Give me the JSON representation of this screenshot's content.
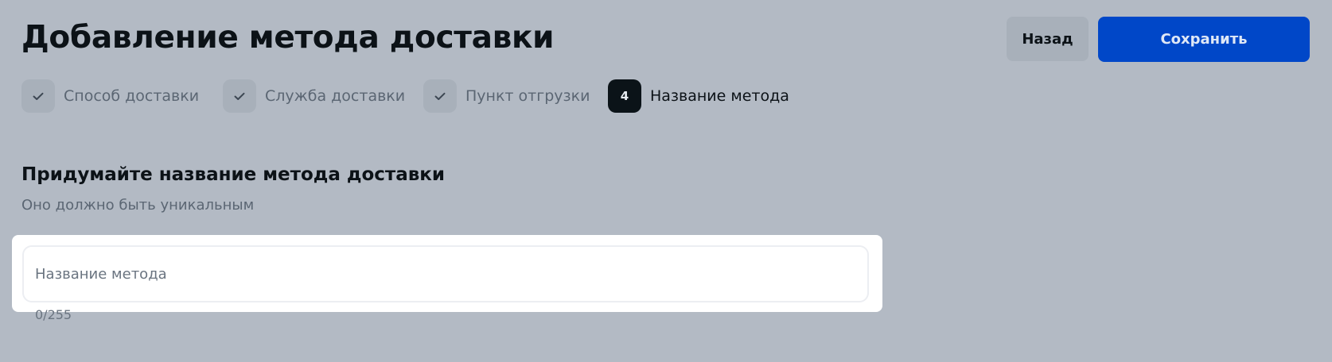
{
  "header": {
    "title": "Добавление метода доставки",
    "back_label": "Назад",
    "save_label": "Сохранить"
  },
  "steps": [
    {
      "badge": "check-icon",
      "label": "Способ доставки",
      "state": "completed"
    },
    {
      "badge": "check-icon",
      "label": "Служба доставки",
      "state": "completed"
    },
    {
      "badge": "check-icon",
      "label": "Пункт отгрузки",
      "state": "completed"
    },
    {
      "badge": "4",
      "label": "Название метода",
      "state": "active"
    }
  ],
  "form": {
    "title": "Придумайте название метода доставки",
    "subtitle": "Оно должно быть уникальным",
    "name_value": "",
    "name_placeholder": "Название метода",
    "counter": "0/255"
  },
  "colors": {
    "background": "#b3bac4",
    "accent": "#0047c8",
    "active_step": "#0b1318"
  }
}
